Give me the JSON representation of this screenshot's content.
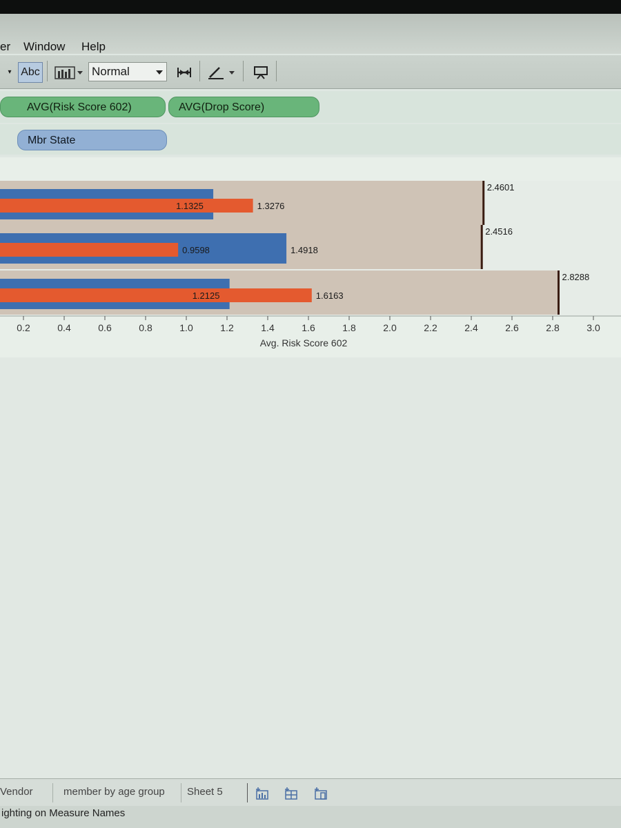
{
  "menu": {
    "items": [
      "er",
      "Window",
      "Help"
    ]
  },
  "toolbar": {
    "abc_label": "Abc",
    "fit_value": "Normal"
  },
  "shelves": {
    "columns_pills": [
      "AVG(Risk Score 602)",
      "AVG(Drop Score)"
    ],
    "rows_pills": [
      "Mbr State"
    ]
  },
  "colors": {
    "blue_series": "#3e6fb0",
    "orange_series": "#e45a2f",
    "reference_line": "#3a1c12"
  },
  "chart_data": {
    "type": "bar",
    "xlabel": "Avg. Risk Score 602",
    "x_ticks": [
      "0.2",
      "0.4",
      "0.6",
      "0.8",
      "1.0",
      "1.2",
      "1.4",
      "1.6",
      "1.8",
      "2.0",
      "2.2",
      "2.4",
      "2.6",
      "2.8",
      "3.0"
    ],
    "xlim": [
      0.0,
      3.05
    ],
    "rows": [
      {
        "blue": 1.1325,
        "orange": 1.3276,
        "ref": 2.4601,
        "blue_label": "1.1325",
        "orange_label": "1.3276",
        "ref_label": "2.4601"
      },
      {
        "blue": 1.4918,
        "orange": 0.9598,
        "ref": 2.4516,
        "blue_label": "1.4918",
        "orange_label": "0.9598",
        "ref_label": "2.4516"
      },
      {
        "blue": 1.2125,
        "orange": 1.6163,
        "ref": 2.8288,
        "blue_label": "1.2125",
        "orange_label": "1.6163",
        "ref_label": "2.8288"
      }
    ]
  },
  "sheet_tabs": [
    "Vendor",
    "member by age group",
    "Sheet 5"
  ],
  "status": {
    "text": "ighting on Measure Names"
  }
}
